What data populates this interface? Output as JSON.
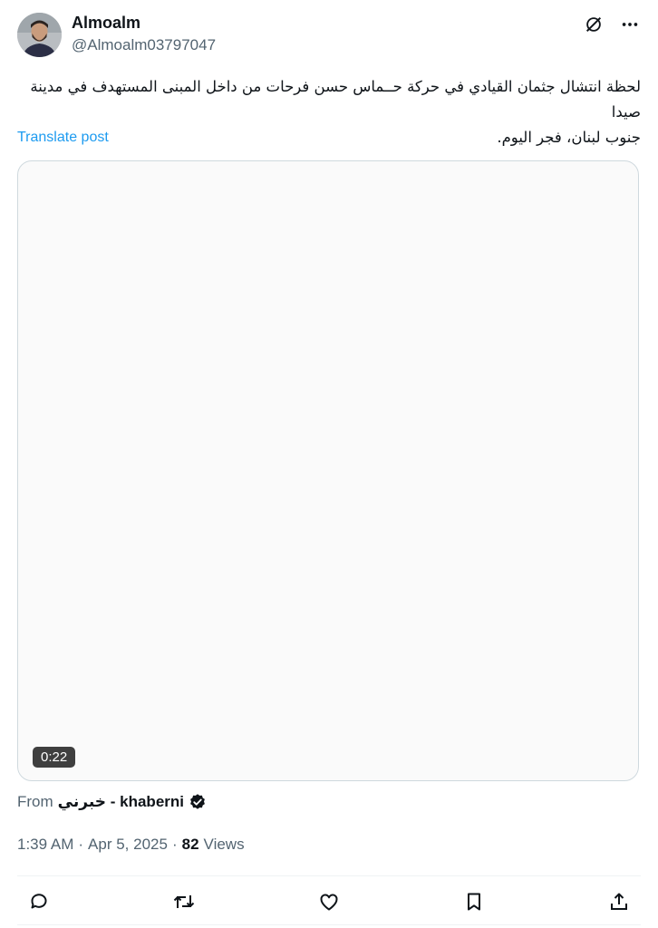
{
  "author": {
    "display_name": "Almoalm",
    "handle": "@Almoalm03797047"
  },
  "post": {
    "text_line1": "لحظة انتشال جثمان القيادي في حركة حــماس حسن فرحات من داخل المبنى المستهدف في مدينة صيدا",
    "text_line2": "جنوب لبنان، فجر اليوم.",
    "translate_label": "Translate post"
  },
  "media": {
    "duration": "0:22"
  },
  "attribution": {
    "prefix": "From",
    "source": "خبرني - khaberni"
  },
  "meta": {
    "time": "1:39 AM",
    "sep1": "·",
    "date": "Apr 5, 2025",
    "sep2": "·",
    "views_count": "82",
    "views_label": "Views"
  },
  "icons": {
    "top": [
      "grok-icon",
      "more-icon"
    ],
    "actions": [
      "reply-icon",
      "repost-icon",
      "like-icon",
      "bookmark-icon",
      "share-icon"
    ]
  }
}
